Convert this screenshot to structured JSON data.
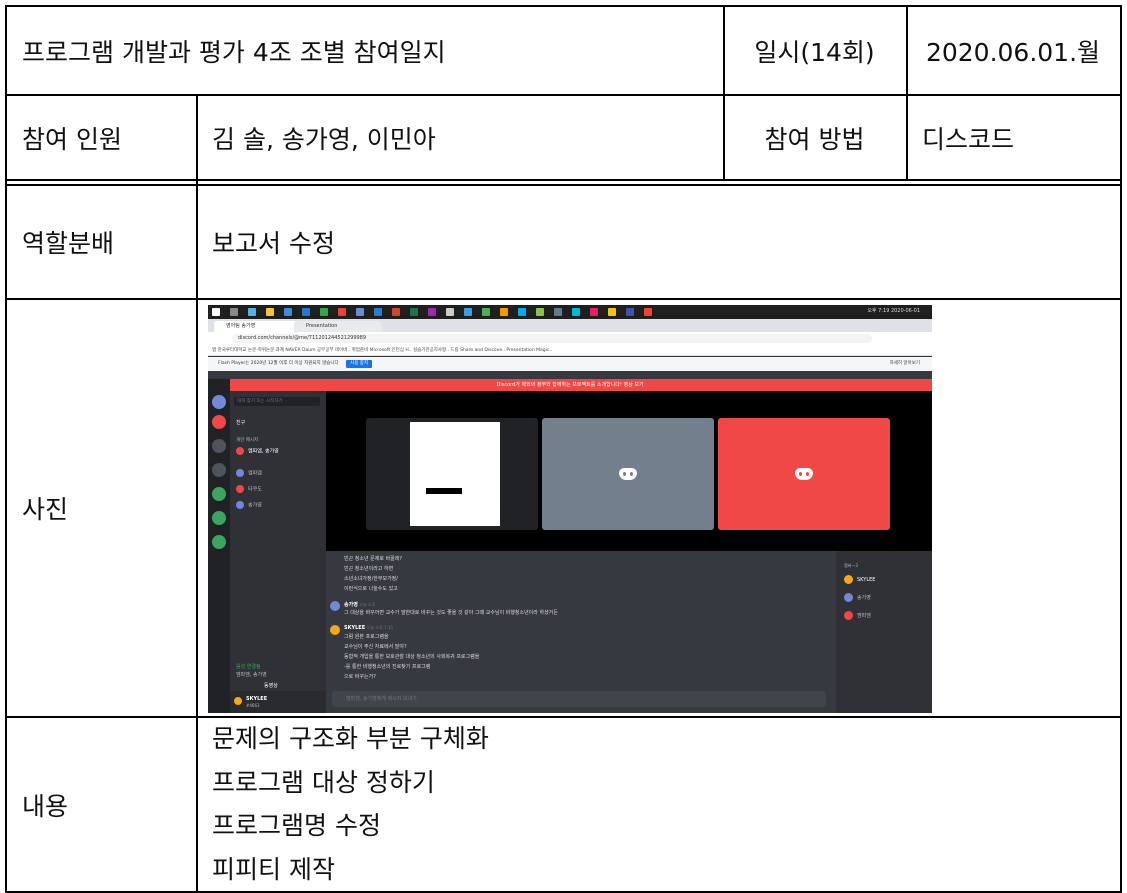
{
  "header": {
    "title": "프로그램 개발과 평가 4조 조별 참여일지",
    "date_label": "일시(14회)",
    "date_value": "2020.06.01.월"
  },
  "participants": {
    "label": "참여 인원",
    "value": "김 솔, 송가영, 이민아",
    "method_label": "참여 방법",
    "method_value": "디스코드"
  },
  "roles": {
    "label": "역할분배",
    "value": "보고서 수정"
  },
  "photo": {
    "label": "사진",
    "screenshot": {
      "tabs": [
        "영어팀 송가영",
        "Presentation"
      ],
      "url": "discord.com/channels/@me/711201244521299989",
      "bookmarks": "앱  한국루터대학교  논문·학위논문  과제  NAVER  Daum  공부공부 네이버..  취업준비  Microsoft 인턴십 H..  실습기관공지사항..  드림  Share and Discove..  Presentation Magic..",
      "flash_notice": "Flash Player는 2020년 12월 이후 더 이상 지원되지 않습니다",
      "flash_button": "사용 중지",
      "flash_right": "자세히 알아보기",
      "banner": "Discord가 해외의 정부와 함께하는 프로젝트를 소개합니다! 영상 보기",
      "search_placeholder": "대화 찾기 또는 시작하기",
      "friends": "친구",
      "dm_header": "개인 메시지",
      "dms": [
        {
          "name": "엠파엠, 송가영",
          "sub": "멤버 3명",
          "color": "#f04747"
        },
        {
          "name": "엠파엠",
          "color": "#7289da"
        },
        {
          "name": "타쿠도",
          "color": "#f04747"
        },
        {
          "name": "송가영",
          "color": "#7289da"
        }
      ],
      "voice_status": "음성 연결됨",
      "voice_channel": "엠파엠, 송가영",
      "video_button": "동영상",
      "self_user": "SKYLEE",
      "self_tag": "#4663",
      "chat_lines": [
        {
          "text": "빈곤 청소년 문제로 바꿀래?"
        },
        {
          "text": "빈곤 청소년이라고 하면"
        },
        {
          "text": "소년소녀가정/한부모가정/"
        },
        {
          "text": "이런식으로 나눌수도 있고"
        },
        {
          "name": "송가영",
          "time": "오늘 오후",
          "text": "그 대상을 바꾸어면 교수가 말한대로 바꾸는 것도 좋을 것 같아 그때 교수님이 비행청소년이라 하셨거든"
        },
        {
          "name": "SKYLEE",
          "time": "오늘 오후 7:15",
          "text": "그럼 원본 프로그램을"
        },
        {
          "text": "교수님이 주신 자료에서 말야?"
        },
        {
          "text": "동합적 개입을 통한 보호관찰 대상 청소년의 사회복귀 프로그램을"
        },
        {
          "text": "-를 통한 비행청소년의 진로찾기 프로그램"
        },
        {
          "text": "으로 바꾸는거?"
        }
      ],
      "member_header": "멤버—3",
      "members": [
        {
          "name": "SKYLEE",
          "color": "#faa61a"
        },
        {
          "name": "송가영",
          "color": "#7289da"
        },
        {
          "name": "엠파엠",
          "color": "#f04747"
        }
      ],
      "message_placeholder": "엠파엠, 송가영에게 메시지 보내기",
      "clock": "오후 7:19",
      "clock_date": "2020-06-01",
      "colors": {
        "discord_blurple": "#7289da",
        "discord_red": "#f04747",
        "tile_gray": "#747f8d"
      }
    }
  },
  "content": {
    "label": "내용",
    "items": [
      "문제의 구조화 부분 구체화",
      "프로그램 대상 정하기",
      "프로그램명 수정",
      "피피티 제작"
    ]
  }
}
